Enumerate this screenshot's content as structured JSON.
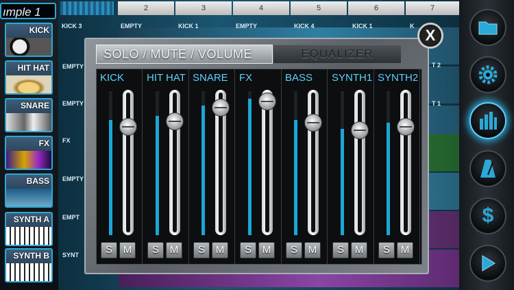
{
  "sample_title": "ımple 1",
  "instruments": [
    {
      "label": "KICK",
      "icon": "drum-icon"
    },
    {
      "label": "HIT HAT",
      "icon": "cymbal-icon"
    },
    {
      "label": "SNARE",
      "icon": "snare-icon"
    },
    {
      "label": "FX",
      "icon": "fx-icon"
    },
    {
      "label": "BASS",
      "icon": "bass-guitar-icon"
    },
    {
      "label": "SYNTH A",
      "icon": "keyboard-icon"
    },
    {
      "label": "SYNTH B",
      "icon": "keyboard-icon"
    }
  ],
  "grid": {
    "column_numbers": [
      "2",
      "3",
      "4",
      "5",
      "6",
      "7"
    ],
    "steps": [
      "KICK 3",
      "EMPTY",
      "KICK 1",
      "EMPTY",
      "KICK 4",
      "KICK 1",
      "K"
    ],
    "row_labels": [
      "EMPTY",
      "EMPTY",
      "FX",
      "EMPTY",
      "EMPT",
      "SYNT"
    ],
    "right_labels": [
      "T 2",
      "T 1"
    ]
  },
  "panel": {
    "tab_active": "SOLO / MUTE / VOLUME",
    "tab_inactive": "EQUALIZER",
    "close_label": "X",
    "solo_label": "S",
    "mute_label": "M",
    "channels": [
      {
        "name": "KICK",
        "volume": 0.8,
        "level": 0.8
      },
      {
        "name": "HIT HAT",
        "volume": 0.84,
        "level": 0.83
      },
      {
        "name": "SNARE",
        "volume": 0.95,
        "level": 0.9
      },
      {
        "name": "FX",
        "volume": 1.0,
        "level": 0.95
      },
      {
        "name": "BASS",
        "volume": 0.83,
        "level": 0.8
      },
      {
        "name": "SYNTH1",
        "volume": 0.77,
        "level": 0.74
      },
      {
        "name": "SYNTH2",
        "volume": 0.8,
        "level": 0.78
      }
    ]
  },
  "toolbar": [
    {
      "icon": "folder-icon",
      "active": false
    },
    {
      "icon": "gear-icon",
      "active": false
    },
    {
      "icon": "mixer-bars-icon",
      "active": true
    },
    {
      "icon": "metronome-icon",
      "active": false
    },
    {
      "icon": "dollar-icon",
      "active": false
    },
    {
      "icon": "play-icon",
      "active": false
    }
  ],
  "colors": {
    "accent": "#2aa9d8",
    "meter": "#1ca6d6",
    "label": "#5fd0ff"
  }
}
